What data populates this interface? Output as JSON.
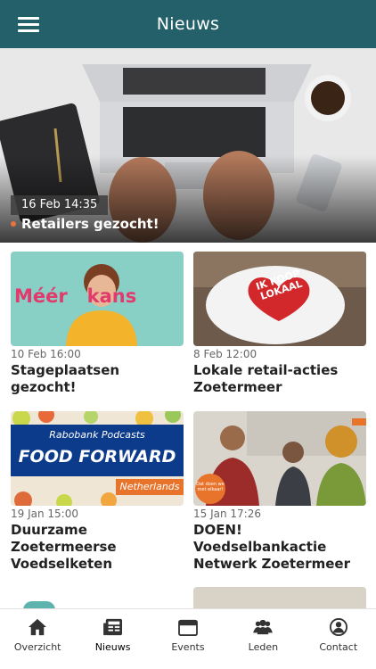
{
  "header": {
    "title": "Nieuws",
    "menu_icon": "hamburger-icon"
  },
  "hero": {
    "date": "16 Feb 14:35",
    "title": "Retailers gezocht!",
    "accent": "#e8743c"
  },
  "cards": [
    {
      "date": "10 Feb 16:00",
      "title": "Stageplaatsen gezocht!",
      "thumb_text": "Méér   kans"
    },
    {
      "date": "8 Feb 12:00",
      "title": "Lokale retail-acties Zoetermeer",
      "thumb_text": "IK KOOP LOKAAL"
    },
    {
      "date": "19 Jan 15:00",
      "title": "Duurzame Zoetermeerse Voedselketen",
      "thumb_brand": "Rabobank Podcasts",
      "thumb_text": "FOOD FORWARD",
      "thumb_sub": "Netherlands"
    },
    {
      "date": "15 Jan 17:26",
      "title": "DOEN! Voedselbankactie Netwerk Zoetermeer",
      "thumb_badge": "Dat doen we met elkaar!"
    }
  ],
  "bottom_nav": [
    {
      "label": "Overzicht",
      "icon": "home-icon"
    },
    {
      "label": "Nieuws",
      "icon": "newspaper-icon"
    },
    {
      "label": "Events",
      "icon": "calendar-icon"
    },
    {
      "label": "Leden",
      "icon": "members-icon"
    },
    {
      "label": "Contact",
      "icon": "contact-icon"
    }
  ],
  "colors": {
    "header": "#24606a",
    "accent": "#e8743c"
  }
}
